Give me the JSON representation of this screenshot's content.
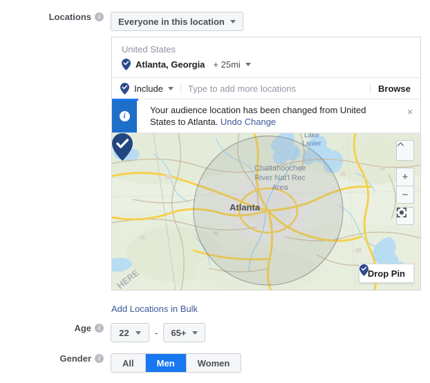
{
  "locations": {
    "label": "Locations",
    "audience_select": "Everyone in this location",
    "country": "United States",
    "place": "Atlanta, Georgia",
    "radius": "+ 25mi",
    "include_label": "Include",
    "search_placeholder": "Type to add more locations",
    "browse_label": "Browse",
    "bulk_link": "Add Locations in Bulk"
  },
  "banner": {
    "message": "Your audience location has been changed from United States to Atlanta.",
    "link": "Undo Change",
    "close": "×"
  },
  "map": {
    "label_lake": "Lake",
    "label_lake2": "Lanier",
    "label_park_1": "Chattahoochee",
    "label_park_2": "River Nat'l Rec",
    "label_park_3": "Area",
    "label_city": "Atlanta",
    "attribution": "HERE",
    "drop_pin": "Drop Pin",
    "zoom_in": "+",
    "zoom_out": "−"
  },
  "age": {
    "label": "Age",
    "min": "22",
    "max": "65+",
    "separator": "-"
  },
  "gender": {
    "label": "Gender",
    "options": [
      {
        "label": "All",
        "selected": false
      },
      {
        "label": "Men",
        "selected": true
      },
      {
        "label": "Women",
        "selected": false
      }
    ]
  },
  "colors": {
    "accent_blue": "#1877f2",
    "banner_blue": "#1d6fc9",
    "link_blue": "#3b5998",
    "pin_blue": "#2b4b8c"
  }
}
